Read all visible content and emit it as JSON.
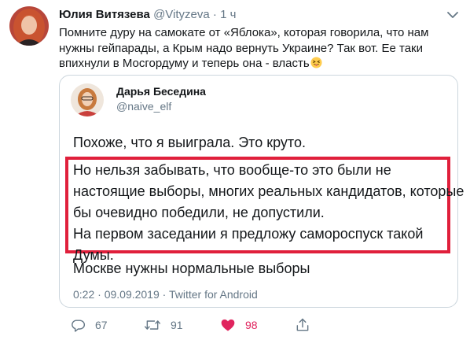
{
  "tweet": {
    "author_name": "Юлия Витязева",
    "author_handle": "@Vityzeva",
    "separator": "·",
    "time": "1 ч",
    "text": "Помните дуру на самокате от «Яблока», которая говорила, что нам нужны гейпарады, а Крым надо вернуть Украине? Так вот. Ее таки впихнули в Мосгордуму и теперь она - власть",
    "emoji": "face-with-tongue-emoji"
  },
  "quoted": {
    "author_name": "Дарья Беседина",
    "author_handle": "@naive_elf",
    "lines": [
      "Похоже, что я выиграла. Это круто.",
      "Но нельзя забывать, что вообще-то это были не",
      "настоящие выборы, многих реальных кандидатов, которые",
      "бы очевидно победили, не допустили.",
      "На первом заседании я предложу самороспуск такой",
      "Думы.",
      "Москве нужны нормальные выборы"
    ],
    "meta": "0:22 · 09.09.2019 · Twitter for Android",
    "highlight_color": "#e01f3b"
  },
  "actions": {
    "reply_count": "67",
    "retweet_count": "91",
    "like_count": "98",
    "like_color": "#e0245e",
    "muted_color": "#657786"
  }
}
